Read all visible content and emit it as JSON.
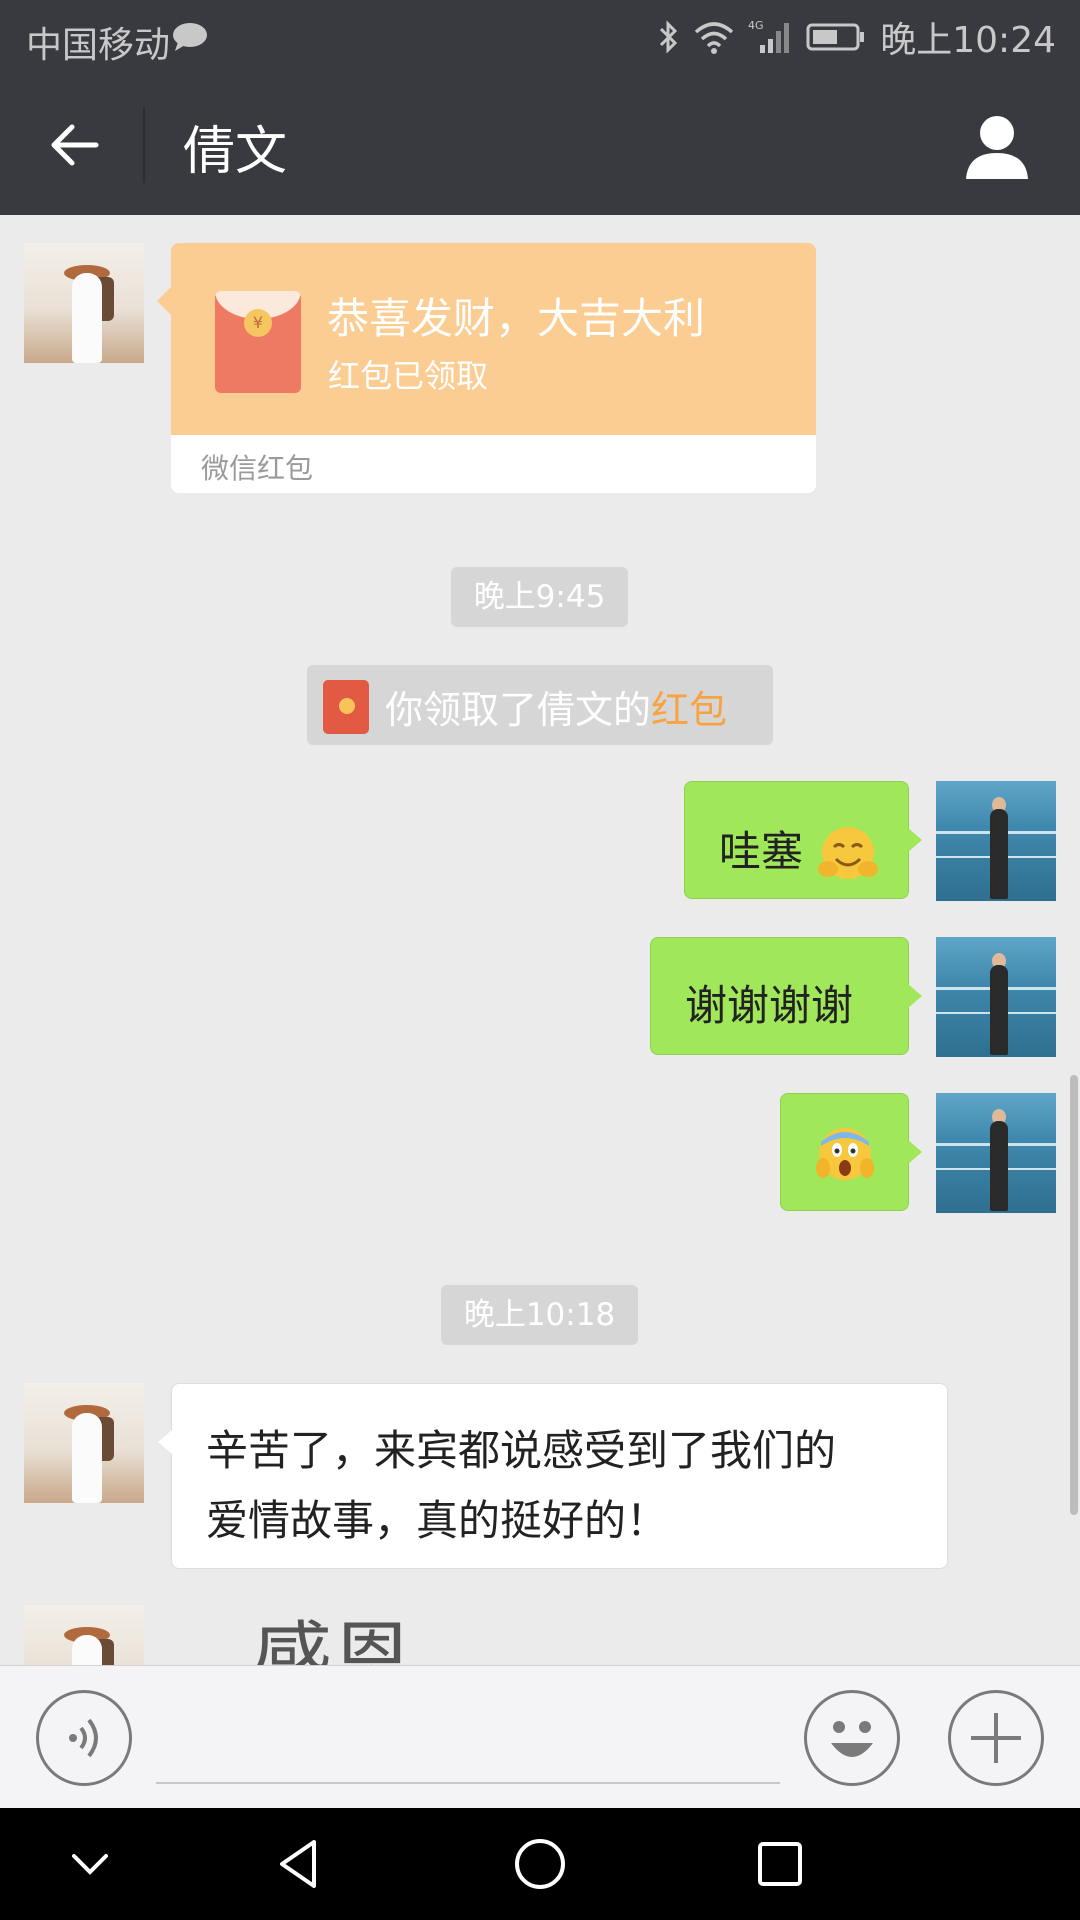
{
  "status_bar": {
    "carrier": "中国移动",
    "network": "4G",
    "time": "晚上10:24"
  },
  "title_bar": {
    "title": "倩文"
  },
  "messages": {
    "red_packet": {
      "title": "恭喜发财，大吉大利",
      "status": "红包已领取",
      "footer": "微信红包",
      "coin_symbol": "¥"
    },
    "timestamp_1": "晚上9:45",
    "system": {
      "prefix": "你领取了倩文的",
      "highlight": "红包"
    },
    "me_1": "哇塞",
    "me_2": "谢谢谢谢",
    "timestamp_2": "晚上10:18",
    "her_text_line1": "辛苦了，来宾都说感受到了我们的",
    "her_text_line2": "爱情故事，真的挺好的！",
    "sticker_text": "感恩"
  },
  "colors": {
    "header": "#393a3f",
    "chat_bg": "#ebebeb",
    "bubble_me": "#a0e75a",
    "packet": "#fbcd93",
    "highlight": "#f7a342"
  },
  "icons": {
    "back": "arrow-left-icon",
    "profile": "person-icon",
    "voice": "voice-icon",
    "emoji": "smiley-icon",
    "more": "plus-icon",
    "nav_down": "chevron-down-icon",
    "nav_back": "triangle-back-icon",
    "nav_home": "circle-home-icon",
    "nav_recent": "square-recent-icon"
  }
}
